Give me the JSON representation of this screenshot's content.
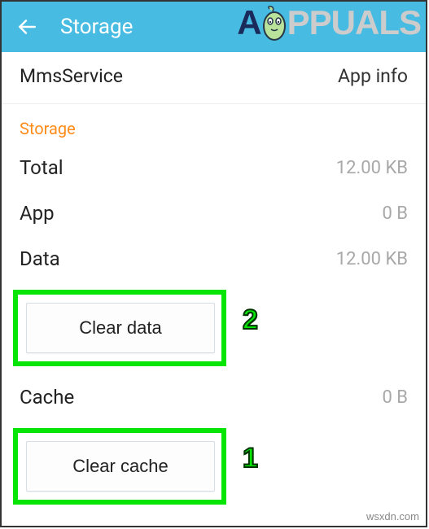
{
  "header": {
    "title": "Storage"
  },
  "app": {
    "name": "MmsService",
    "info_label": "App info"
  },
  "section": {
    "title": "Storage"
  },
  "stats": {
    "total": {
      "label": "Total",
      "value": "12.00 KB"
    },
    "app": {
      "label": "App",
      "value": "0 B"
    },
    "data": {
      "label": "Data",
      "value": "12.00 KB"
    },
    "cache": {
      "label": "Cache",
      "value": "0 B"
    }
  },
  "buttons": {
    "clear_data": "Clear data",
    "clear_cache": "Clear cache"
  },
  "annotations": {
    "num1": "1",
    "num2": "2"
  },
  "watermark": {
    "brand_a": "A",
    "brand_rest": "PPUALS",
    "site": "wsxdn.com"
  }
}
